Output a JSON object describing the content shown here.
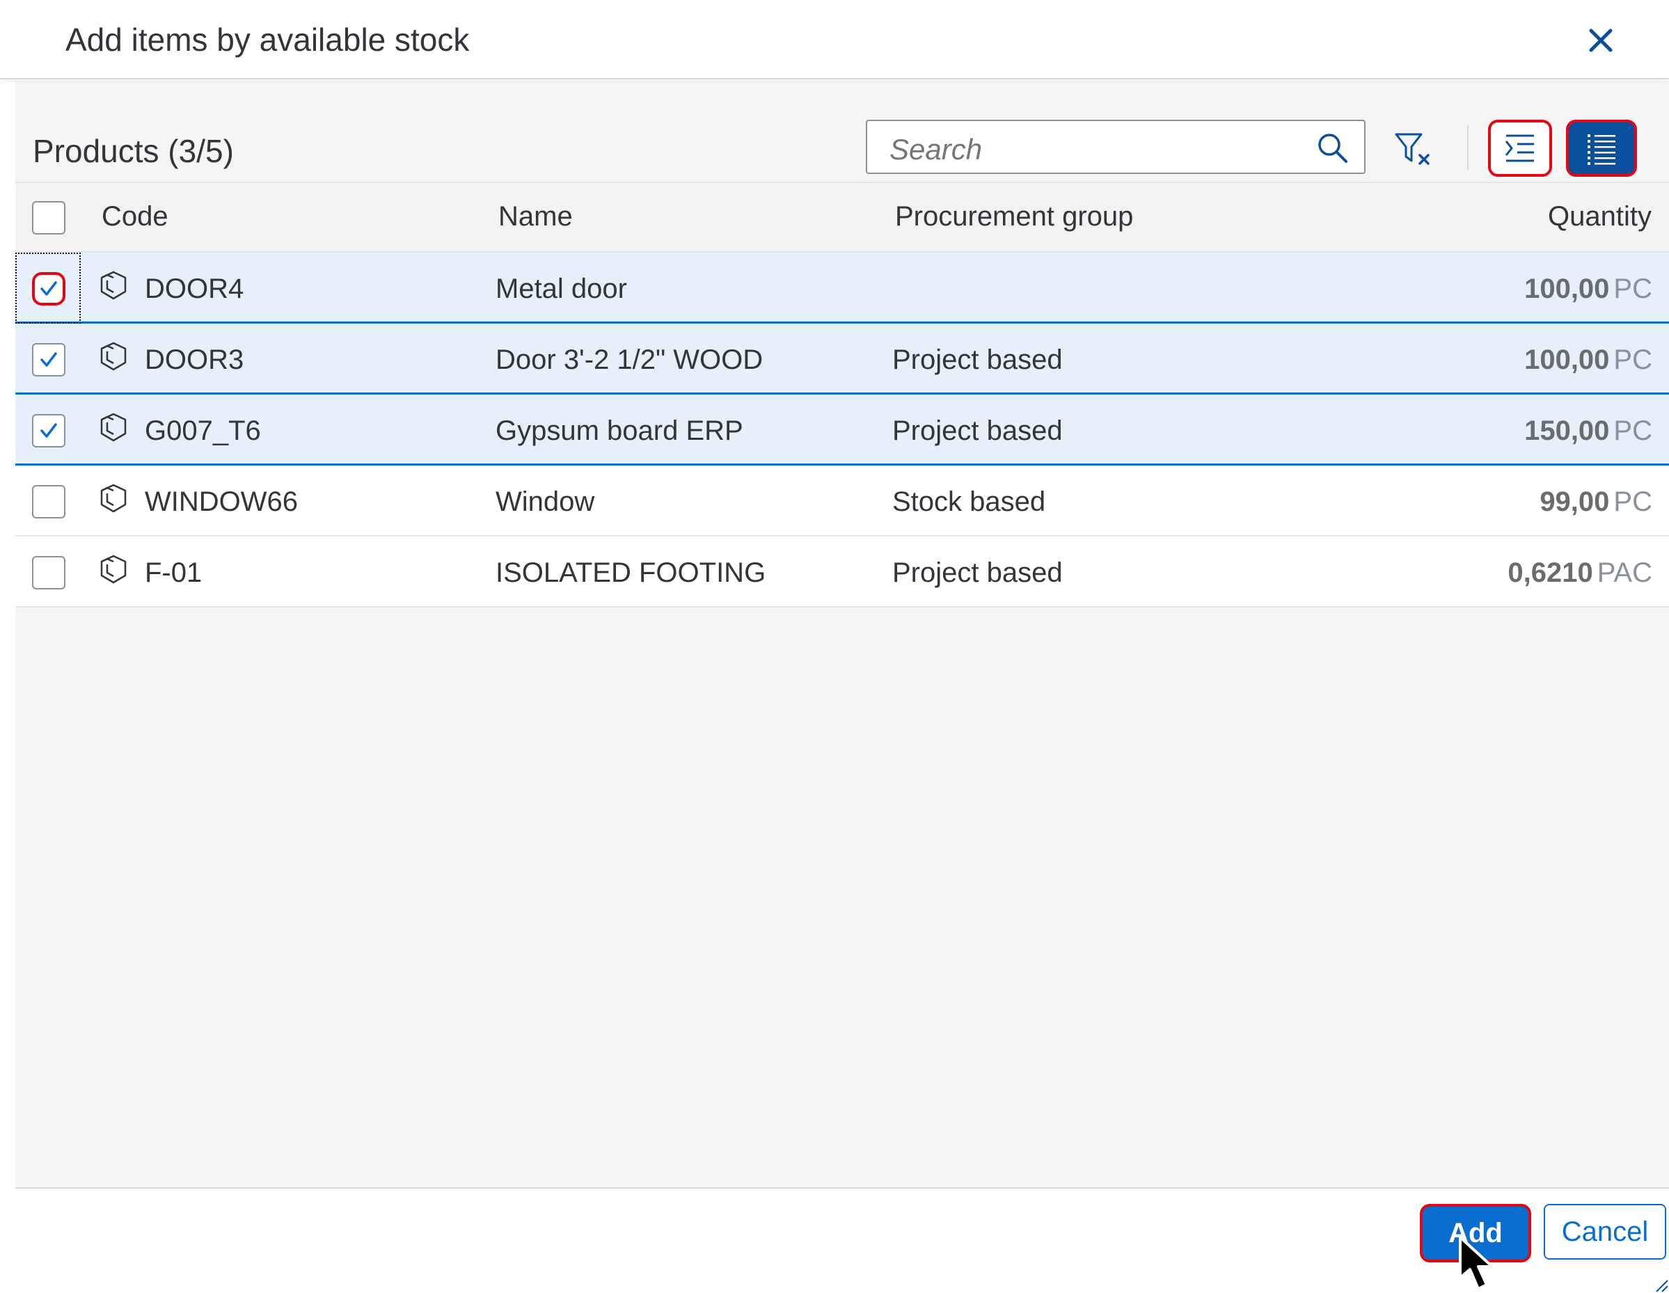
{
  "dialog": {
    "title": "Add items by available stock"
  },
  "toolbar": {
    "title": "Products (3/5)",
    "search_placeholder": "Search",
    "filter_icon": "filter-clear-icon",
    "collapse_icon": "collapse-indent-icon",
    "list_icon": "list-view-icon"
  },
  "table": {
    "columns": {
      "code": "Code",
      "name": "Name",
      "group": "Procurement group",
      "quantity": "Quantity"
    },
    "rows": [
      {
        "code": "DOOR4",
        "name": "Metal door",
        "group": "",
        "qty": "100,00",
        "unit": "PC",
        "checked": true
      },
      {
        "code": "DOOR3",
        "name": "Door 3'-2 1/2\" WOOD",
        "group": "Project based",
        "qty": "100,00",
        "unit": "PC",
        "checked": true
      },
      {
        "code": "G007_T6",
        "name": "Gypsum board ERP",
        "group": "Project based",
        "qty": "150,00",
        "unit": "PC",
        "checked": true
      },
      {
        "code": "WINDOW66",
        "name": "Window",
        "group": "Stock based",
        "qty": "99,00",
        "unit": "PC",
        "checked": false
      },
      {
        "code": "F-01",
        "name": "ISOLATED FOOTING",
        "group": "Project based",
        "qty": "0,6210",
        "unit": "PAC",
        "checked": false
      }
    ]
  },
  "footer": {
    "add_label": "Add",
    "cancel_label": "Cancel"
  },
  "colors": {
    "brand": "#0a6ed1",
    "dark_brand": "#0a4f9e",
    "highlight": "#e30613",
    "selected_row": "#e5f0fa"
  }
}
